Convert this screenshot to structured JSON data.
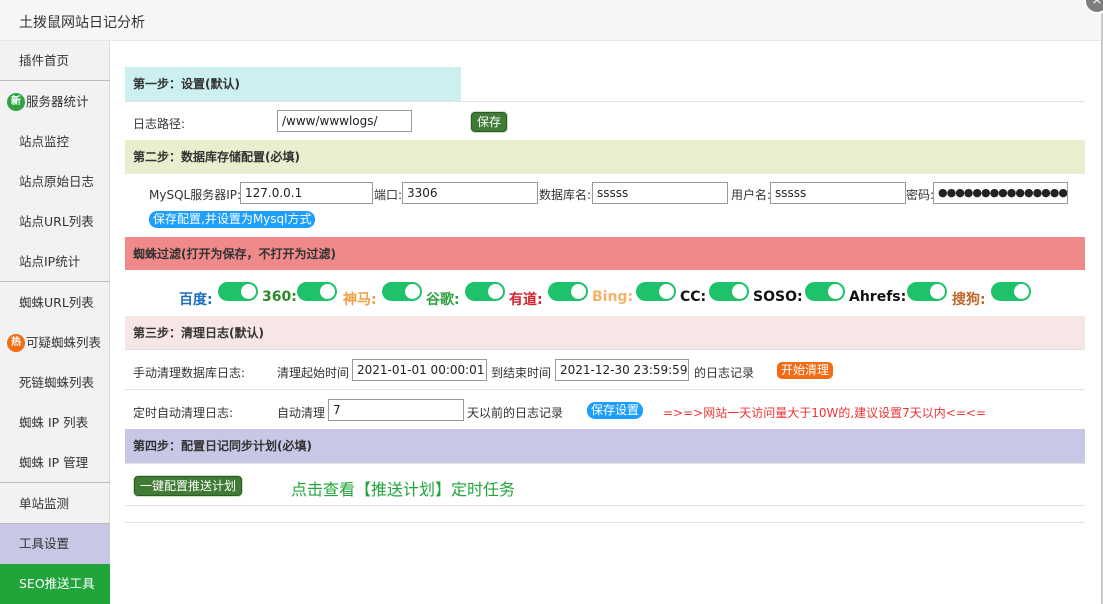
{
  "window": {
    "title": "土拨鼠网站日记分析",
    "close_icon": "×"
  },
  "sidebar": {
    "items": [
      {
        "label": "插件首页"
      },
      {
        "label": "服务器统计",
        "badge": "新"
      },
      {
        "label": "站点监控"
      },
      {
        "label": "站点原始日志"
      },
      {
        "label": "站点URL列表"
      },
      {
        "label": "站点IP统计"
      },
      {
        "label": "蜘蛛URL列表"
      },
      {
        "label": "可疑蜘蛛列表",
        "badge": "热"
      },
      {
        "label": "死链蜘蛛列表"
      },
      {
        "label": "蜘蛛 IP 列表"
      },
      {
        "label": "蜘蛛 IP 管理"
      },
      {
        "label": "单站监测"
      },
      {
        "label": "工具设置"
      },
      {
        "label": "SEO推送工具"
      }
    ]
  },
  "step1": {
    "title": "第一步：设置(默认)",
    "log_path_label": "日志路径:",
    "log_path_value": "/www/wwwlogs/",
    "save_label": "保存"
  },
  "step2": {
    "title": "第二步：数据库存储配置(必填)",
    "server_ip_label": "MySQL服务器IP:",
    "server_ip_value": "127.0.0.1",
    "port_label": "端口:",
    "port_value": "3306",
    "dbname_label": "数据库名:",
    "dbname_value": "sssss",
    "user_label": "用户名:",
    "user_value": "sssss",
    "password_label": "密码:",
    "password_value": "●●●●●●●●●●●●●●●●",
    "save_label": "保存配置,并设置为Mysql方式"
  },
  "spider_filter": {
    "title": "蜘蛛过滤(打开为保存，不打开为过滤)",
    "spiders": [
      {
        "name": "百度:",
        "color": "#1e6fbf"
      },
      {
        "name": "360:",
        "color": "#2a8a2a"
      },
      {
        "name": "神马:",
        "color": "#f0a040"
      },
      {
        "name": "谷歌:",
        "color": "#2fa341"
      },
      {
        "name": "有道:",
        "color": "#d0252f"
      },
      {
        "name": "Bing:",
        "color": "#f5b36a"
      },
      {
        "name": "CC:",
        "color": "#111111"
      },
      {
        "name": "SOSO:",
        "color": "#111111"
      },
      {
        "name": "Ahrefs:",
        "color": "#111111"
      },
      {
        "name": "搜狗:",
        "color": "#c0662a"
      }
    ]
  },
  "step3": {
    "title": "第三步：清理日志(默认)",
    "manual_label": "手动清理数据库日志:",
    "start_label": "清理起始时间",
    "start_value": "2021-01-01 00:00:01",
    "end_label": "到结束时间",
    "end_value": "2021-12-30 23:59:59",
    "suffix_label": "的日志记录",
    "clean_label": "开始清理",
    "auto_label": "定时自动清理日志:",
    "auto_prefix": "自动清理",
    "auto_days": "7",
    "auto_suffix": "天以前的日志记录",
    "auto_save_label": "保存设置",
    "auto_note": "=>=>网站一天访问量大于10W的,建议设置7天以内<=<="
  },
  "step4": {
    "title": "第四步：配置日记同步计划(必填)",
    "config_label": "一键配置推送计划",
    "view_link": "点击查看【推送计划】定时任务"
  },
  "colors": {
    "step1_bg": "#ccefef",
    "step2_bg": "#e7efcf",
    "spider_bg": "#f08a8a",
    "step3_bg": "#f6e6e6",
    "step4_bg": "#c8c8e6",
    "toggle_on": "#1ec26a"
  }
}
